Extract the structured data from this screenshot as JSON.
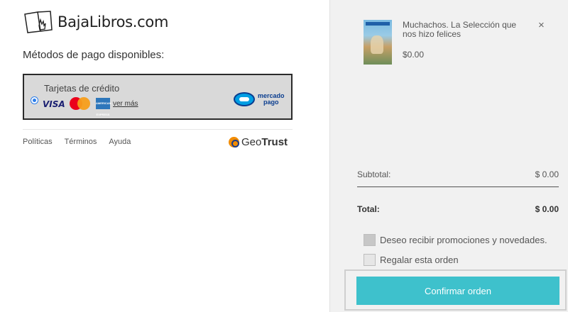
{
  "brand": {
    "logo_text": "BajaLibros.com",
    "icon": "book-hand-icon"
  },
  "payment": {
    "section_title": "Métodos de pago disponibles:",
    "option_label": "Tarjetas de crédito",
    "visa_text": "VISA",
    "amex_text": "AMERICAN EXPRESS",
    "more_link": "ver más",
    "mp_line1": "mercado",
    "mp_line2": "pago"
  },
  "footer": {
    "links": [
      "Políticas",
      "Términos",
      "Ayuda"
    ],
    "geotrust_prefix": "Geo",
    "geotrust_bold": "Trust"
  },
  "cart": {
    "item": {
      "title": "Muchachos. La Selección que nos hizo felices",
      "price": "$0.00",
      "remove_glyph": "×"
    },
    "subtotal_label": "Subtotal:",
    "subtotal_value": "$ 0.00",
    "total_label": "Total:",
    "total_value": "$ 0.00",
    "options": [
      "Deseo recibir promociones y novedades.",
      "Regalar esta orden"
    ],
    "confirm_label": "Confirmar orden"
  },
  "colors": {
    "confirm_button": "#3ec1cc",
    "right_panel_bg": "#f1f1f1",
    "payment_box_bg": "#d9d9d9"
  }
}
